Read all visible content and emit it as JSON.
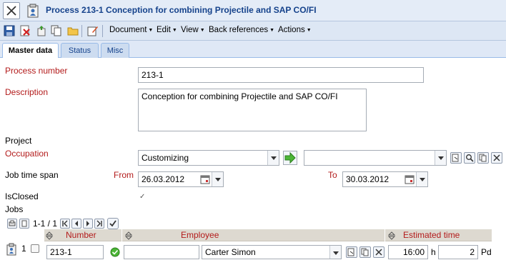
{
  "title": "Process 213-1 Conception for combining Projectile and SAP CO/FI",
  "toolbar": {
    "menus": [
      "Document",
      "Edit",
      "View",
      "Back references",
      "Actions"
    ]
  },
  "tabs": [
    "Master data",
    "Status",
    "Misc"
  ],
  "form": {
    "process_number_label": "Process number",
    "process_number_value": "213-1",
    "description_label": "Description",
    "description_value": "Conception for combining Projectile and SAP CO/FI",
    "project_label": "Project",
    "occupation_label": "Occupation",
    "occupation_value": "Customizing",
    "occupation_second_value": "",
    "job_time_span_label": "Job time span",
    "from_label": "From",
    "from_value": "26.03.2012",
    "to_label": "To",
    "to_value": "30.03.2012",
    "isclosed_label": "IsClosed",
    "isclosed_mark": "✓",
    "jobs_label": "Jobs"
  },
  "jobs": {
    "pager_text": "1-1 / 1",
    "columns": [
      "Number",
      "Employee",
      "Estimated time"
    ],
    "rows": [
      {
        "index": "1",
        "number": "213-1",
        "employee_code": "",
        "employee": "Carter Simon",
        "time": "16:00",
        "time_unit": "h",
        "days": "2",
        "days_unit": "Pd"
      }
    ]
  }
}
